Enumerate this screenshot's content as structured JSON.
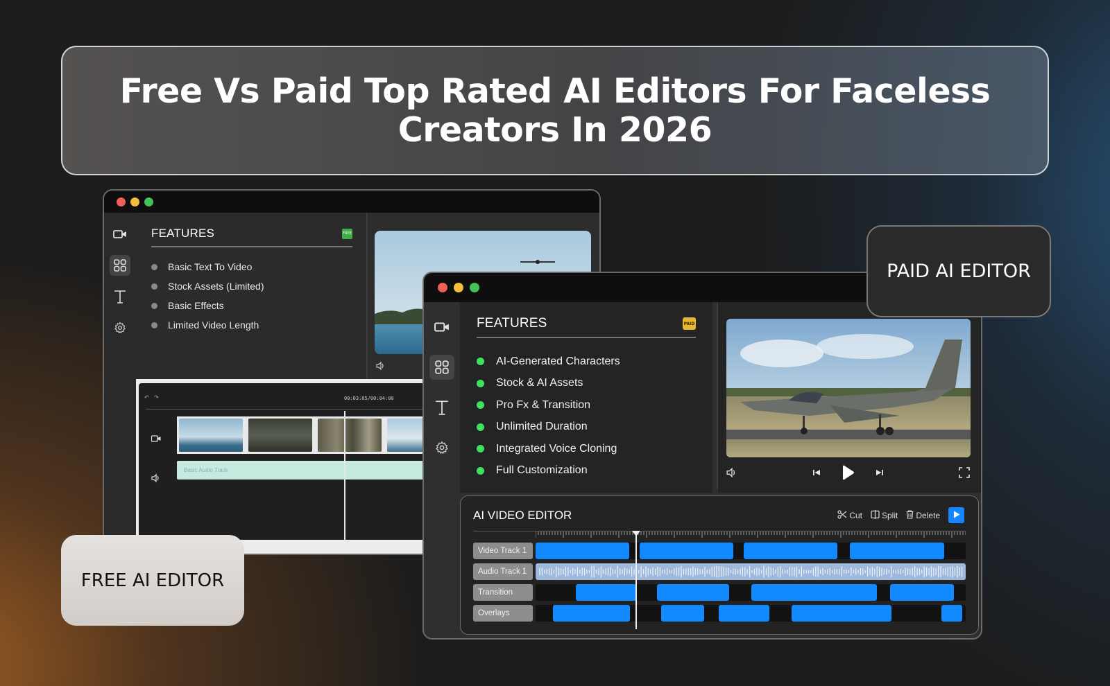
{
  "title": "Free Vs Paid Top Rated AI Editors For Faceless Creators In 2026",
  "free_editor": {
    "features_title": "FEATURES",
    "badge": "FREE",
    "features": [
      "Basic Text To Video",
      "Stock Assets (Limited)",
      "Basic Effects",
      "Limited Video Length"
    ],
    "timecode": "00:03:05/00:04:00",
    "audio_track_label": "Basic Audio Track",
    "label": "FREE AI EDITOR"
  },
  "paid_editor": {
    "features_title": "FEATURES",
    "badge": "PAID",
    "features": [
      "AI-Generated Characters",
      "Stock & AI Assets",
      "Pro Fx & Transition",
      "Unlimited Duration",
      "Integrated Voice Cloning",
      "Full Customization"
    ],
    "editor_title": "AI VIDEO EDITOR",
    "tools": {
      "cut": "Cut",
      "split": "Split",
      "delete": "Delete"
    },
    "tracks": [
      "Video Track 1",
      "Audio Track 1",
      "Transition",
      "Overlays"
    ],
    "label": "PAID AI EDITOR"
  },
  "colors": {
    "accent_blue": "#1389ff",
    "paid_badge": "#e8b635",
    "free_badge": "#3fae4a",
    "bullet_green": "#3ee25b"
  },
  "icons": [
    "video-camera-icon",
    "grid-icon",
    "text-icon",
    "gear-icon",
    "volume-icon",
    "skip-back-icon",
    "play-icon",
    "skip-forward-icon",
    "fullscreen-icon",
    "scissors-icon",
    "split-icon",
    "trash-icon",
    "undo-icon",
    "redo-icon"
  ]
}
